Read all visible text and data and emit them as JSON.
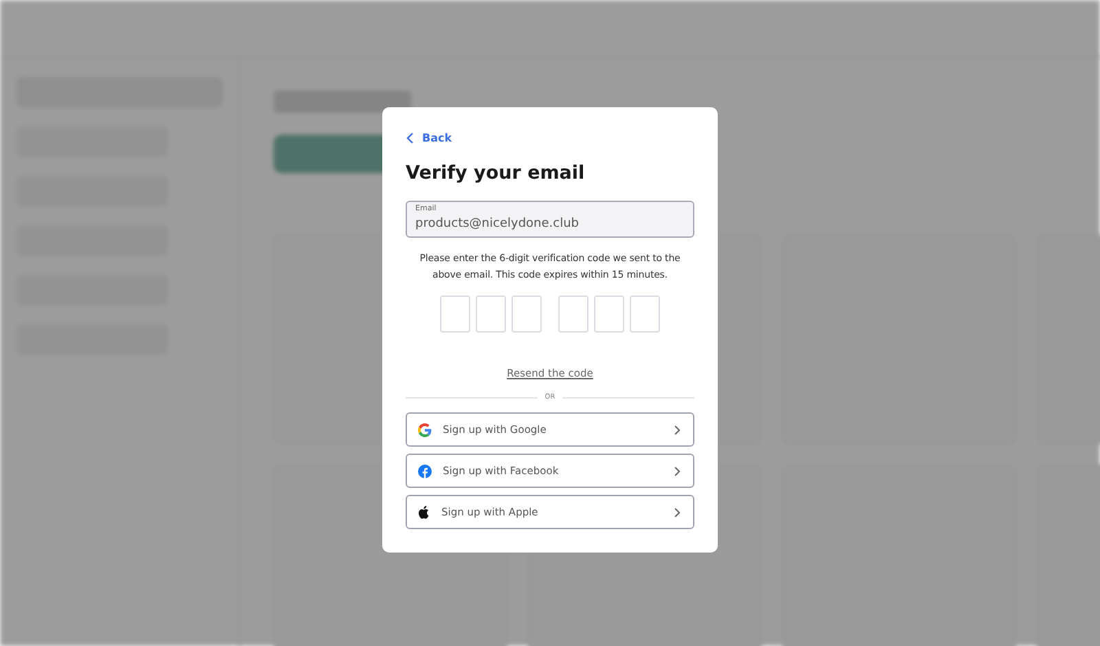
{
  "dialog": {
    "back": "Back",
    "title": "Verify your email",
    "email": {
      "label": "Email",
      "value": "products@nicelydone.club"
    },
    "instructions": "Please enter the 6-digit verification code we sent to the above email. This code expires within 15 minutes.",
    "resend": "Resend the code",
    "divider": "OR",
    "providers": [
      {
        "kind": "google",
        "label": "Sign up with Google"
      },
      {
        "kind": "facebook",
        "label": "Sign up with Facebook"
      },
      {
        "kind": "apple",
        "label": "Sign up with Apple"
      }
    ]
  }
}
